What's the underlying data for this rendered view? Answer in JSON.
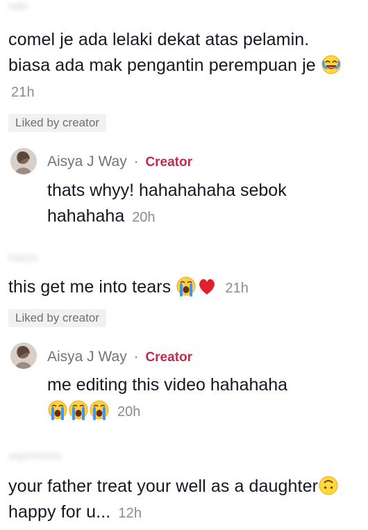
{
  "comments": [
    {
      "username": "iaile",
      "text": "comel je ada lelaki dekat atas pelamin. biasa ada mak pengantin perempuan je",
      "emoji": "laughing-emoji",
      "time": "21h",
      "liked_badge": "Liked by creator",
      "reply": {
        "author": "Aisya J Way",
        "separator": "·",
        "role": "Creator",
        "text": "thats whyy! hahahahaha sebok hahahaha",
        "time": "20h"
      }
    },
    {
      "username": "haeys",
      "text": "this get me into tears",
      "emojis": [
        "crying-face-emoji",
        "red-heart-emoji"
      ],
      "time": "21h",
      "liked_badge": "Liked by creator",
      "reply": {
        "author": "Aisya J Way",
        "separator": "·",
        "role": "Creator",
        "text": "me editing this video hahahaha",
        "emojis": [
          "crying-face-emoji",
          "crying-face-emoji",
          "crying-face-emoji"
        ],
        "time": "20h"
      }
    },
    {
      "username": "aqiemsess",
      "text": "your father treat your well as a daughter",
      "emoji": "upside-down-face-emoji",
      "text_after": "happy for u...",
      "time": "12h"
    }
  ],
  "colors": {
    "primary_text": "#161823",
    "muted_text": "#8a8b91",
    "creator_accent": "#c42b4b",
    "badge_background": "#f1f1f2"
  }
}
